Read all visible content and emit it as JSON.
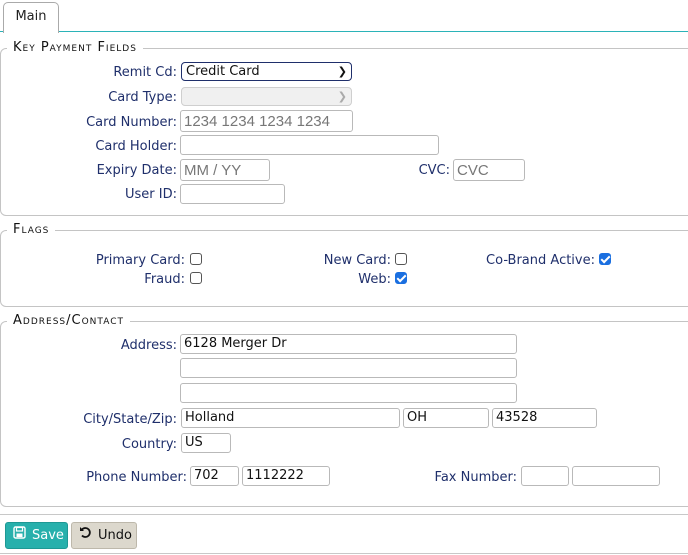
{
  "tabs": [
    {
      "label": "Main",
      "active": true
    }
  ],
  "sections": {
    "key_payment": {
      "title": "Key Payment Fields",
      "remit_cd": {
        "label": "Remit Cd:",
        "value": "Credit Card"
      },
      "card_type": {
        "label": "Card Type:",
        "value": ""
      },
      "card_number": {
        "label": "Card Number:",
        "value": "",
        "placeholder": "1234 1234 1234 1234"
      },
      "card_holder": {
        "label": "Card Holder:",
        "value": ""
      },
      "expiry_date": {
        "label": "Expiry Date:",
        "value": "",
        "placeholder": "MM / YY"
      },
      "cvc": {
        "label": "CVC:",
        "value": "",
        "placeholder": "CVC"
      },
      "user_id": {
        "label": "User ID:",
        "value": ""
      }
    },
    "flags": {
      "title": "Flags",
      "primary_card": {
        "label": "Primary Card:",
        "checked": false
      },
      "new_card": {
        "label": "New Card:",
        "checked": false
      },
      "co_brand_active": {
        "label": "Co-Brand Active:",
        "checked": true
      },
      "fraud": {
        "label": "Fraud:",
        "checked": false
      },
      "web": {
        "label": "Web:",
        "checked": true
      }
    },
    "address": {
      "title": "Address/Contact",
      "address_label": "Address:",
      "address_line1": "6128 Merger Dr",
      "address_line2": "",
      "address_line3": "",
      "city_state_zip_label": "City/State/Zip:",
      "city": "Holland",
      "state": "OH",
      "zip": "43528",
      "country_label": "Country:",
      "country": "US",
      "phone_label": "Phone Number:",
      "phone_area": "702",
      "phone_number": "1112222",
      "fax_label": "Fax Number:",
      "fax_area": "",
      "fax_number": ""
    }
  },
  "actions": {
    "save": {
      "label": "Save",
      "icon": "floppy-disk-icon"
    },
    "undo": {
      "label": "Undo",
      "icon": "undo-icon"
    }
  },
  "colors": {
    "accent": "#27b0ac",
    "label": "#1f2f6b",
    "checkbox_on": "#1a6fe0"
  }
}
